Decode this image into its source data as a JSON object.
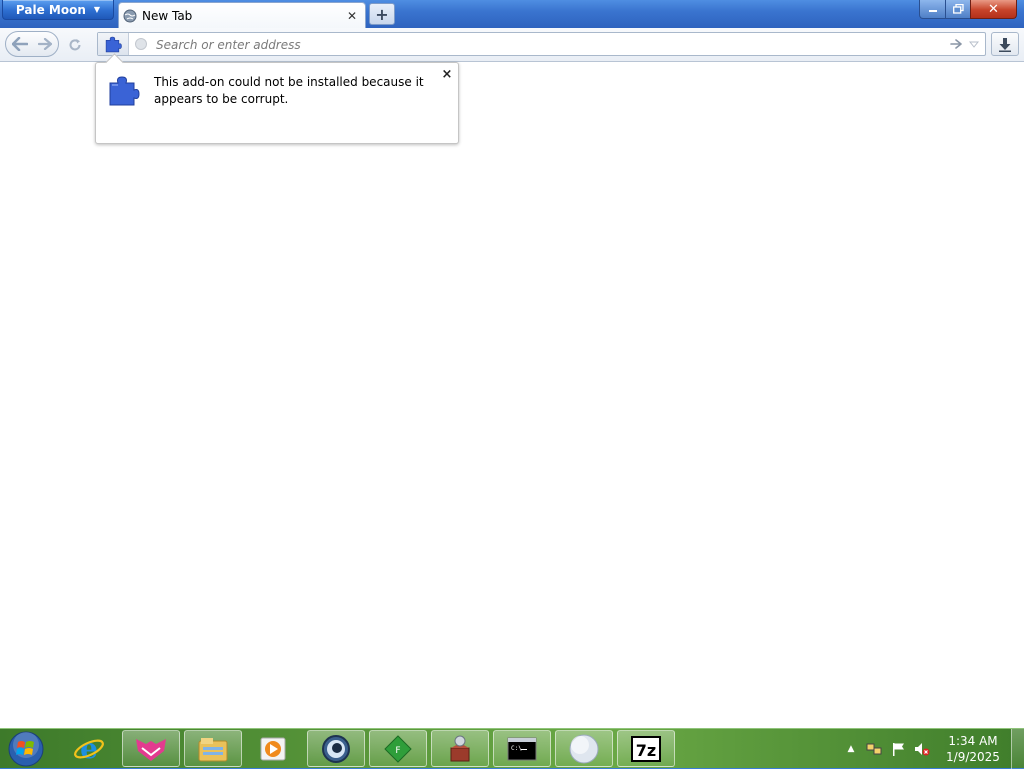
{
  "browser": {
    "app_button_label": "Pale Moon",
    "tabs": [
      {
        "title": "New Tab"
      }
    ],
    "new_tab_label": "+",
    "window_controls": {
      "minimize": "–",
      "maximize": "▢",
      "close": "✕"
    }
  },
  "navbar": {
    "address": {
      "value": "",
      "placeholder": "Search or enter address"
    }
  },
  "notification": {
    "message": "This add-on could not be installed because it appears to be corrupt.",
    "close_label": "×",
    "icon": "puzzle-piece-icon"
  },
  "taskbar": {
    "pinned": [
      "internet-explorer-icon",
      "foxy-app-icon",
      "file-explorer-icon",
      "media-player-icon",
      "globe-app-icon",
      "green-diamond-app-icon",
      "archive-box-app-icon",
      "command-prompt-icon",
      "pale-moon-icon",
      "7zip-icon"
    ],
    "clock": {
      "time": "1:34 AM",
      "date": "1/9/2025"
    }
  },
  "colors": {
    "accent_blue": "#3a74cf",
    "taskbar_green": "#5c9a3c",
    "close_red": "#c7442a"
  }
}
